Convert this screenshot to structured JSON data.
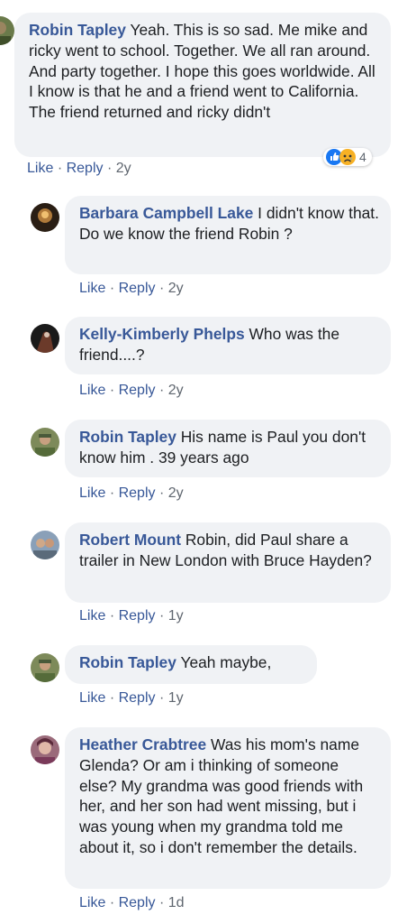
{
  "comments": [
    {
      "author": "Robin Tapley",
      "text": "Yeah. This is so sad. Me mike and ricky went to school. Together. We all ran around. And party together. I hope this goes worldwide. All I know is that he and a friend went to California. The friend returned and ricky didn't",
      "like": "Like",
      "reply": "Reply",
      "sep": "·",
      "time": "2y",
      "reaction_count": "4",
      "reaction_icons": [
        "like-icon",
        "sad-icon"
      ]
    },
    {
      "author": "Barbara Campbell Lake",
      "text": "I didn't know that. Do we know the friend Robin ?",
      "like": "Like",
      "reply": "Reply",
      "sep": "·",
      "time": "2y"
    },
    {
      "author": "Kelly-Kimberly Phelps",
      "text": "Who was the friend....?",
      "like": "Like",
      "reply": "Reply",
      "sep": "·",
      "time": "2y"
    },
    {
      "author": "Robin Tapley",
      "text": "His name is Paul you don't know him . 39 years ago",
      "like": "Like",
      "reply": "Reply",
      "sep": "·",
      "time": "2y"
    },
    {
      "author": "Robert Mount",
      "text": "Robin, did Paul share a trailer in New London with Bruce Hayden?",
      "like": "Like",
      "reply": "Reply",
      "sep": "·",
      "time": "1y"
    },
    {
      "author": "Robin Tapley",
      "text": "Yeah maybe,",
      "like": "Like",
      "reply": "Reply",
      "sep": "·",
      "time": "1y"
    },
    {
      "author": "Heather Crabtree",
      "text": "Was his mom's name Glenda? Or am i thinking of someone else? My grandma was good friends with her, and her son had went missing, but i was young when my grandma told me about it, so i don't remember the details.",
      "like": "Like",
      "reply": "Reply",
      "sep": "·",
      "time": "1d"
    }
  ],
  "colors": {
    "link": "#385898",
    "meta": "#606770",
    "bubble": "#f0f2f5",
    "text": "#1c1e21",
    "like_blue": "#1877f2",
    "sad_yellow": "#f7b125"
  }
}
